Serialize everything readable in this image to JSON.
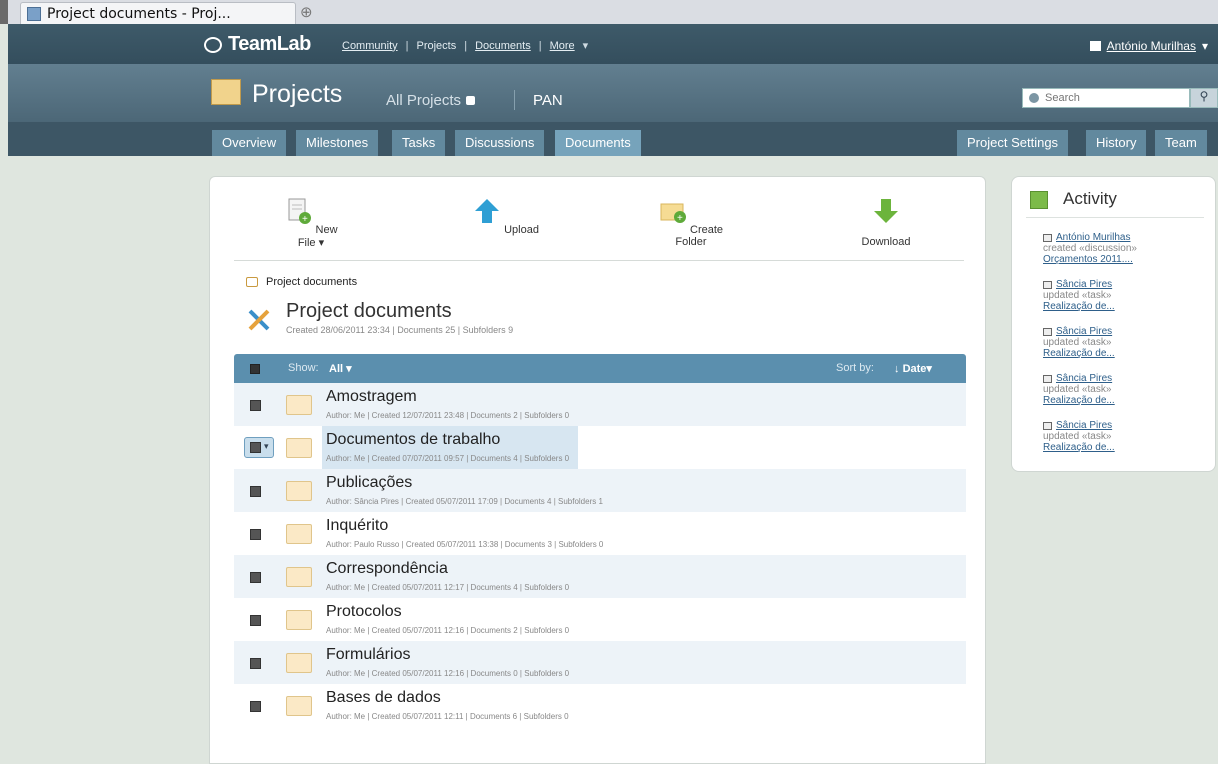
{
  "browser": {
    "tab_title": "Project documents - Proj...",
    "new_tab": "⊕"
  },
  "topbar": {
    "logo": "TeamLab",
    "links": [
      "Community",
      "Projects",
      "Documents",
      "More"
    ],
    "user": "António Murilhas"
  },
  "header": {
    "title": "Projects",
    "all_projects": "All Projects",
    "project": "PAN",
    "search_placeholder": "Search"
  },
  "nav": {
    "left": [
      "Overview",
      "Milestones",
      "Tasks",
      "Discussions",
      "Documents"
    ],
    "right": [
      "Project Settings",
      "History",
      "Team"
    ],
    "active": "Documents"
  },
  "toolbar": {
    "new_file": "New File",
    "upload": "Upload",
    "create_folder": "Create Folder",
    "download": "Download"
  },
  "breadcrumb": "Project documents",
  "doc": {
    "title": "Project documents",
    "meta": "Created 28/06/2011 23:34 | Documents 25 | Subfolders 9"
  },
  "list": {
    "show_label": "Show:",
    "show_value": "All",
    "sort_label": "Sort by:",
    "sort_value": "Date",
    "folders": [
      {
        "name": "Amostragem",
        "meta": "Author: Me | Created 12/07/2011 23:48 | Documents 2 | Subfolders 0"
      },
      {
        "name": "Documentos de trabalho",
        "meta": "Author: Me | Created 07/07/2011 09:57 | Documents 4 | Subfolders 0"
      },
      {
        "name": "Publicações",
        "meta": "Author: Sância Pires | Created 05/07/2011 17:09 | Documents 4 | Subfolders 1"
      },
      {
        "name": "Inquérito",
        "meta": "Author: Paulo Russo | Created 05/07/2011 13:38 | Documents 3 | Subfolders 0"
      },
      {
        "name": "Correspondência",
        "meta": "Author: Me | Created 05/07/2011 12:17 | Documents 4 | Subfolders 0"
      },
      {
        "name": "Protocolos",
        "meta": "Author: Me | Created 05/07/2011 12:16 | Documents 2 | Subfolders 0"
      },
      {
        "name": "Formulários",
        "meta": "Author: Me | Created 05/07/2011 12:16 | Documents 0 | Subfolders 0"
      },
      {
        "name": "Bases de dados",
        "meta": "Author: Me | Created 05/07/2011 12:11 | Documents 6 | Subfolders 0"
      }
    ]
  },
  "activity": {
    "title": "Activity",
    "items": [
      {
        "user": "António Murilhas",
        "action": "created «discussion»",
        "target": "Orçamentos 2011...."
      },
      {
        "user": "Sância Pires",
        "action": "updated «task»",
        "target": "Realização de..."
      },
      {
        "user": "Sância Pires",
        "action": "updated «task»",
        "target": "Realização de..."
      },
      {
        "user": "Sância Pires",
        "action": "updated «task»",
        "target": "Realização de..."
      },
      {
        "user": "Sância Pires",
        "action": "updated «task»",
        "target": "Realização de..."
      }
    ]
  },
  "colors": {
    "navy": "#3e5a69",
    "tab_active": "#76a3bb",
    "list_header": "#5b8fae",
    "link": "#2e5f8a"
  }
}
